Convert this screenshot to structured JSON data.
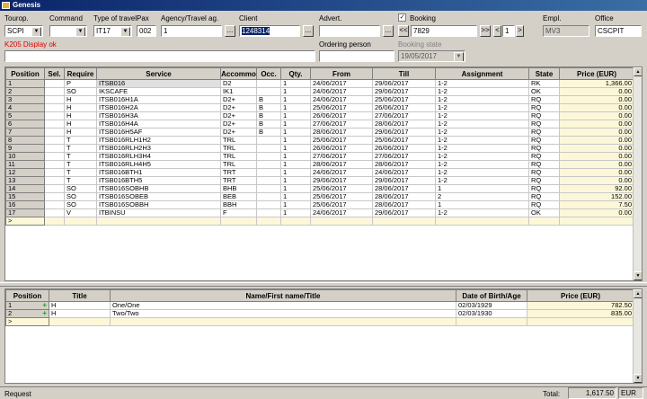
{
  "window": {
    "title": "Genesis"
  },
  "header": {
    "tourop_label": "Tourop.",
    "tourop_value": "SCPI",
    "command_label": "Command",
    "command_value": "",
    "type_label": "Type of travel",
    "type_value": "IT17",
    "pax_label": "Pax",
    "pax_value": "002",
    "agency_label": "Agency/Travel ag.",
    "agency_value": "1",
    "client_label": "Client",
    "client_value": "1248314",
    "advert_label": "Advert.",
    "advert_value": "",
    "booking_label": "Booking",
    "booking_checked": true,
    "booking_value": "7829",
    "booking_page": "1",
    "empl_label": "Empl.",
    "empl_value": "MV3",
    "office_label": "Office",
    "office_value": "CSCPIT",
    "message": "K205 Display ok",
    "ordering_label": "Ordering person",
    "ordering_value": "",
    "booking_state_label": "Booking state",
    "booking_state_value": "19/05/2017",
    "ellipsis": "...",
    "prev": "<<",
    "next": ">>",
    "minus": "<",
    "plus_btn": ">",
    "dropdown": "▼"
  },
  "services": {
    "columns": [
      "Position",
      "Sel.",
      "Require",
      "Service",
      "Accommo",
      "Occ.",
      "Qty.",
      "From",
      "Till",
      "Assignment",
      "State",
      "Price (EUR)"
    ],
    "rows": [
      [
        "1",
        "",
        "P",
        "ITSB016",
        "D2",
        "",
        "1",
        "24/06/2017",
        "29/06/2017",
        "1-2",
        "RK",
        "1,366.00"
      ],
      [
        "2",
        "",
        "SO",
        "IKSCAFE",
        "IK1",
        "",
        "1",
        "24/06/2017",
        "29/06/2017",
        "1-2",
        "OK",
        "0.00"
      ],
      [
        "3",
        "",
        "H",
        "ITSB016H1A",
        "D2+",
        "B",
        "1",
        "24/06/2017",
        "25/06/2017",
        "1-2",
        "RQ",
        "0.00"
      ],
      [
        "4",
        "",
        "H",
        "ITSB016H2A",
        "D2+",
        "B",
        "1",
        "25/06/2017",
        "26/06/2017",
        "1-2",
        "RQ",
        "0.00"
      ],
      [
        "5",
        "",
        "H",
        "ITSB016H3A",
        "D2+",
        "B",
        "1",
        "26/06/2017",
        "27/06/2017",
        "1-2",
        "RQ",
        "0.00"
      ],
      [
        "6",
        "",
        "H",
        "ITSB016H4A",
        "D2+",
        "B",
        "1",
        "27/06/2017",
        "28/06/2017",
        "1-2",
        "RQ",
        "0.00"
      ],
      [
        "7",
        "",
        "H",
        "ITSB016H5AF",
        "D2+",
        "B",
        "1",
        "28/06/2017",
        "29/06/2017",
        "1-2",
        "RQ",
        "0.00"
      ],
      [
        "8",
        "",
        "T",
        "ITSB016RLH1H2",
        "TRL",
        "",
        "1",
        "25/06/2017",
        "25/06/2017",
        "1-2",
        "RQ",
        "0.00"
      ],
      [
        "9",
        "",
        "T",
        "ITSB016RLH2H3",
        "TRL",
        "",
        "1",
        "26/06/2017",
        "26/06/2017",
        "1-2",
        "RQ",
        "0.00"
      ],
      [
        "10",
        "",
        "T",
        "ITSB016RLH3H4",
        "TRL",
        "",
        "1",
        "27/06/2017",
        "27/06/2017",
        "1-2",
        "RQ",
        "0.00"
      ],
      [
        "11",
        "",
        "T",
        "ITSB016RLH4H5",
        "TRL",
        "",
        "1",
        "28/06/2017",
        "28/06/2017",
        "1-2",
        "RQ",
        "0.00"
      ],
      [
        "12",
        "",
        "T",
        "ITSB016BTH1",
        "TRT",
        "",
        "1",
        "24/06/2017",
        "24/06/2017",
        "1-2",
        "RQ",
        "0.00"
      ],
      [
        "13",
        "",
        "T",
        "ITSB016BTH5",
        "TRT",
        "",
        "1",
        "29/06/2017",
        "29/06/2017",
        "1-2",
        "RQ",
        "0.00"
      ],
      [
        "14",
        "",
        "SO",
        "ITSB016SOBHB",
        "BHB",
        "",
        "1",
        "25/06/2017",
        "28/06/2017",
        "1",
        "RQ",
        "92.00"
      ],
      [
        "15",
        "",
        "SO",
        "ITSB016SOBEB",
        "BEB",
        "",
        "1",
        "25/06/2017",
        "28/06/2017",
        "2",
        "RQ",
        "152.00"
      ],
      [
        "16",
        "",
        "SO",
        "ITSB016SOBBH",
        "BBH",
        "",
        "1",
        "25/06/2017",
        "28/06/2017",
        "1",
        "RQ",
        "7.50"
      ],
      [
        "17",
        "",
        "V",
        "ITBINSU",
        "F",
        "",
        "1",
        "24/06/2017",
        "29/06/2017",
        "1-2",
        "OK",
        "0.00"
      ]
    ],
    "new_row_marker": ">"
  },
  "passengers": {
    "columns": [
      "Position",
      "Title",
      "Name/First name/Title",
      "Date of Birth/Age",
      "Price (EUR)"
    ],
    "rows": [
      [
        "1",
        "H",
        "One/One",
        "02/03/1929",
        "782.50"
      ],
      [
        "2",
        "H",
        "Two/Two",
        "02/03/1930",
        "835.00"
      ]
    ],
    "plus_mark": "+",
    "new_row_marker": ">"
  },
  "status": {
    "request_label": "Request",
    "total_label": "Total:",
    "total_value": "1,617.50",
    "currency": "EUR"
  }
}
